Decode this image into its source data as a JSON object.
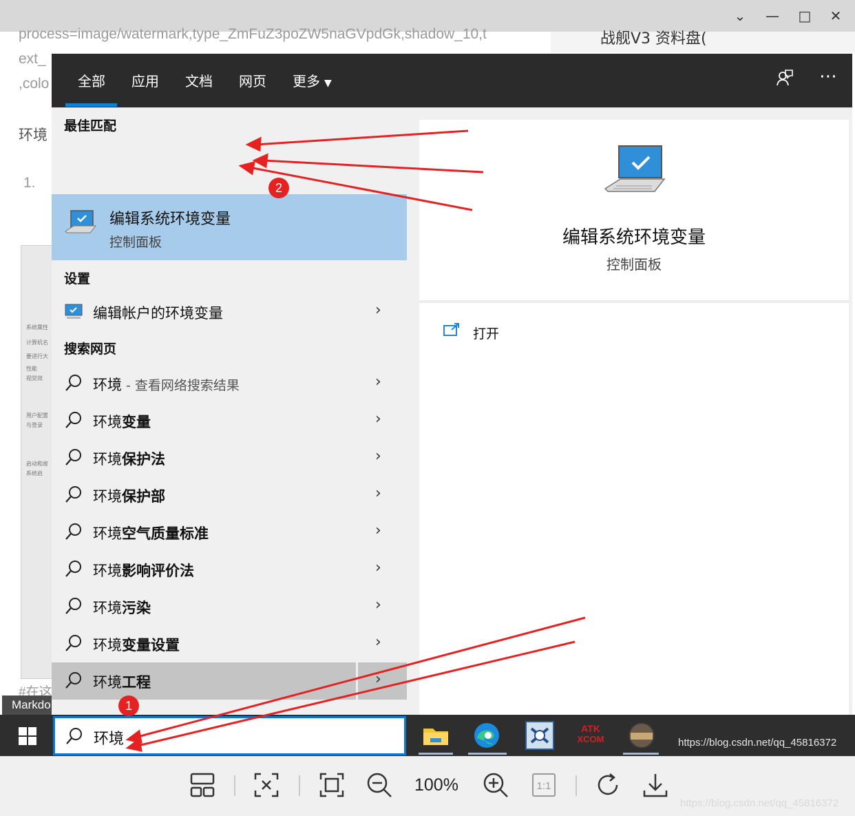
{
  "background_doc": {
    "line1": "process=image/watermark,type_ZmFuZ3poZW5naGVpdGk,shadow_10,t",
    "line2": "ext_",
    "line3": ",colo",
    "para": "环境",
    "list_num": "1.",
    "top_right_text": "战舰V3 资料盘(",
    "footer_text": "#在这",
    "markdown_tab": "Markdo",
    "thumb_lines": [
      "系统属性",
      "计算机名",
      "要进行大",
      "性能",
      "视觉效",
      "用户配置",
      "与登录",
      "启动和故",
      "系统启"
    ]
  },
  "nav": {
    "tabs": [
      "全部",
      "应用",
      "文档",
      "网页",
      "更多"
    ],
    "active_tab": "全部"
  },
  "sections": {
    "best_match": "最佳匹配",
    "settings": "设置",
    "web": "搜索网页"
  },
  "best": {
    "title": "编辑系统环境变量",
    "subtitle": "控制面板"
  },
  "settings_item": "编辑帐户的环境变量",
  "web_results": [
    {
      "prefix": "环境",
      "bold": "",
      "suffix": " - 查看网络搜索结果"
    },
    {
      "prefix": "环境",
      "bold": "变量",
      "suffix": ""
    },
    {
      "prefix": "环境",
      "bold": "保护法",
      "suffix": ""
    },
    {
      "prefix": "环境",
      "bold": "保护部",
      "suffix": ""
    },
    {
      "prefix": "环境",
      "bold": "空气质量标准",
      "suffix": ""
    },
    {
      "prefix": "环境",
      "bold": "影响评价法",
      "suffix": ""
    },
    {
      "prefix": "环境",
      "bold": "污染",
      "suffix": ""
    },
    {
      "prefix": "环境",
      "bold": "变量设置",
      "suffix": ""
    },
    {
      "prefix": "环境",
      "bold": "工程",
      "suffix": ""
    }
  ],
  "preview": {
    "title": "编辑系统环境变量",
    "subtitle": "控制面板",
    "open_label": "打开"
  },
  "search": {
    "query": "环境"
  },
  "taskbar": {
    "apps": [
      "file-explorer-icon",
      "edge-icon",
      "qq-tool-icon",
      "atk-xcom-icon",
      "photo-app-icon"
    ],
    "atk_top": "ATK",
    "atk_bottom": "XCOM"
  },
  "watermark": "https://blog.csdn.net/qq_45816372",
  "viewer": {
    "zoom": "100%"
  },
  "badges": [
    "1",
    "2"
  ],
  "colors": {
    "accent": "#0a78d4",
    "best_match_bg": "#a7cbea",
    "annotation": "#e52222",
    "navbar": "#2b2b2b"
  }
}
